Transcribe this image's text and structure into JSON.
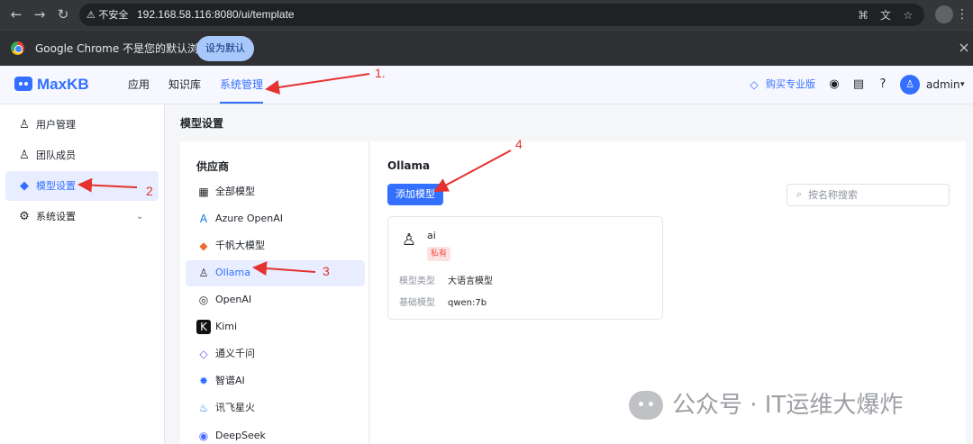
{
  "browser": {
    "navigation": {
      "back": "←",
      "forward": "→",
      "reload": "↻"
    },
    "security_label": "不安全",
    "url": "192.168.58.116:8080/ui/template",
    "omnibox_icons": [
      "key-icon",
      "translate-icon",
      "star-icon"
    ],
    "profile_icon": "profile-icon",
    "menu_icon": "⋮"
  },
  "infobar": {
    "message": "Google Chrome 不是您的默认浏览器",
    "set_default_label": "设为默认",
    "close_label": "×"
  },
  "app": {
    "brand": "MaxKB",
    "tabs": [
      {
        "label": "应用"
      },
      {
        "label": "知识库"
      },
      {
        "label": "系统管理"
      }
    ],
    "buy_pro_label": "购买专业版",
    "header_icons": [
      "github-icon",
      "document-icon",
      "help-icon"
    ],
    "user_name": "admin",
    "user_caret": "▾"
  },
  "sidebar": {
    "items": [
      {
        "label": "用户管理",
        "icon": "user-icon",
        "glyph": "♙"
      },
      {
        "label": "团队成员",
        "icon": "team-icon",
        "glyph": "♙"
      },
      {
        "label": "模型设置",
        "icon": "cube-icon",
        "glyph": "◆"
      },
      {
        "label": "系统设置",
        "icon": "settings-icon",
        "glyph": "⚙"
      }
    ],
    "expand_icon": "⌄"
  },
  "page": {
    "title": "模型设置",
    "provider_title": "供应商",
    "providers": [
      {
        "label": "全部模型",
        "icon": "grid-icon",
        "glyph": "▦"
      },
      {
        "label": "Azure OpenAI",
        "icon": "azure-icon",
        "glyph": "A"
      },
      {
        "label": "千帆大模型",
        "icon": "qianfan-icon",
        "glyph": "◆"
      },
      {
        "label": "Ollama",
        "icon": "ollama-icon",
        "glyph": "♙"
      },
      {
        "label": "OpenAI",
        "icon": "openai-icon",
        "glyph": "◎"
      },
      {
        "label": "Kimi",
        "icon": "kimi-icon",
        "glyph": "K"
      },
      {
        "label": "通义千问",
        "icon": "tongyi-icon",
        "glyph": "◇"
      },
      {
        "label": "智谱AI",
        "icon": "zhipu-icon",
        "glyph": "✹"
      },
      {
        "label": "讯飞星火",
        "icon": "spark-icon",
        "glyph": "♨"
      },
      {
        "label": "DeepSeek",
        "icon": "deepseek-icon",
        "glyph": "◉"
      }
    ],
    "selected_provider": "Ollama",
    "add_model_label": "添加模型",
    "search_placeholder": "按名称搜索",
    "search_value": "",
    "model_card": {
      "name": "ai",
      "badge": "私有",
      "type_label": "模型类型",
      "type_value": "大语言模型",
      "base_label": "基础模型",
      "base_value": "qwen:7b"
    }
  },
  "annotations": [
    "1.",
    "2",
    "3",
    "4"
  ],
  "watermark": {
    "text": "公众号 · IT运维大爆炸"
  },
  "colors": {
    "primary": "#3370FF",
    "annotation": "#E5312F",
    "chrome_dark": "#35363A",
    "infobar_dark": "#2F3033",
    "sidebar_active": "#E8EEFF",
    "private_badge": "#FDE2E2"
  }
}
